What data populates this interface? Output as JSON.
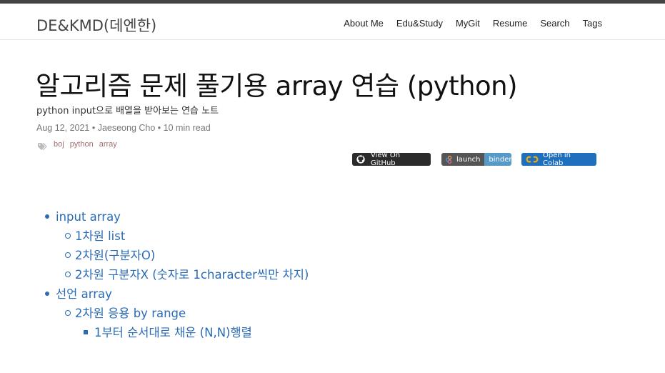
{
  "site": {
    "title": "DE&KMD(데엔한)"
  },
  "nav": [
    {
      "label": "About Me"
    },
    {
      "label": "Edu&Study"
    },
    {
      "label": "MyGit"
    },
    {
      "label": "Resume"
    },
    {
      "label": "Search"
    },
    {
      "label": "Tags"
    }
  ],
  "post": {
    "title": "알고리즘 문제 풀기용 array 연습 (python)",
    "description": "python input으로 배열을 받아보는 연습 노트",
    "meta": "Aug 12, 2021 • Jaeseong Cho • 10 min read",
    "tags": [
      {
        "label": "boj"
      },
      {
        "label": "python"
      },
      {
        "label": "array"
      }
    ]
  },
  "badges": {
    "github": {
      "label": "View On GitHub"
    },
    "binder": {
      "left": "launch",
      "right": "binder"
    },
    "colab": {
      "label": "Open in Colab"
    }
  },
  "toc": {
    "item1": {
      "label": "input array"
    },
    "item1_sub": [
      {
        "label": "1차원 list"
      },
      {
        "label": "2차원(구분자O)"
      },
      {
        "label": "2차원 구분자X (숫자로 1character씩만 차지)"
      }
    ],
    "item2": {
      "label": "선언 array"
    },
    "item2_sub": {
      "label": "2차원 응용 by range"
    },
    "item2_sub_sub": {
      "label": "1부터 순서대로 채운 (N,N)행렬"
    }
  },
  "colors": {
    "link": "#2a6bb5",
    "tag": "#a36e6e",
    "github_badge": "#2b2b2b",
    "binder_left": "#555555",
    "binder_right": "#579aca",
    "colab_badge": "#1f6fbf"
  }
}
